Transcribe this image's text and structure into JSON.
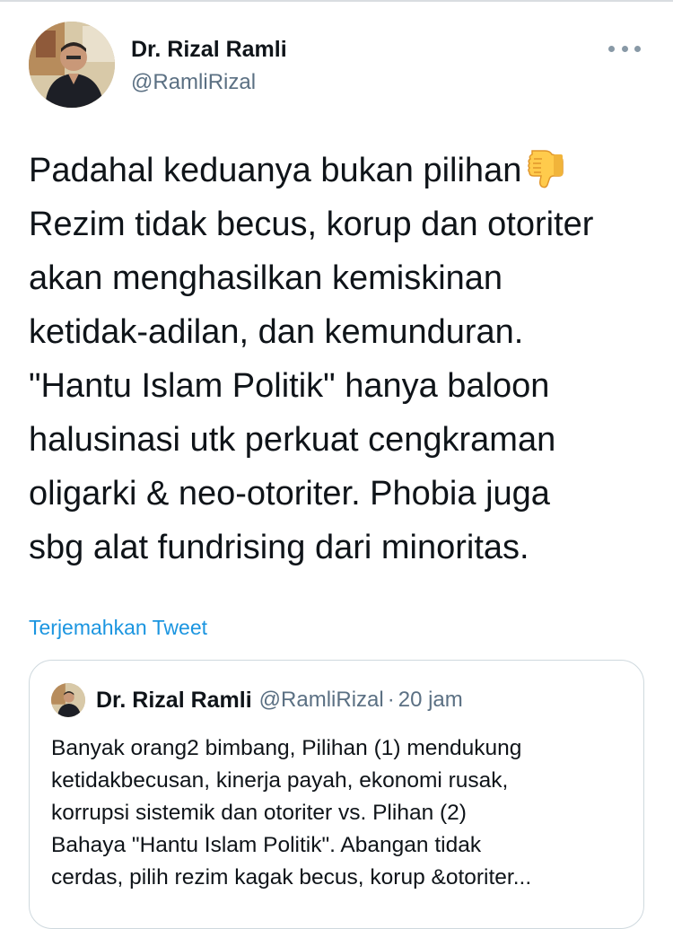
{
  "tweet": {
    "author_name": "Dr. Rizal Ramli",
    "author_handle": "@RamliRizal",
    "text_line1": "Padahal keduanya bukan pilihan",
    "text_rest": "Rezim tidak becus, korup dan otoriter\nakan menghasilkan kemiskinan\nketidak-adilan, dan kemunduran.\n\"Hantu Islam Politik\" hanya baloon\nhalusinasi utk perkuat cengkraman\noligarki & neo-otoriter. Phobia juga\nsbg alat fundrising dari minoritas.",
    "emoji": "thumbs-down-emoji",
    "translate_label": "Terjemahkan Tweet"
  },
  "quoted": {
    "author_name": "Dr. Rizal Ramli",
    "author_handle": "@RamliRizal",
    "separator": "·",
    "time": "20 jam",
    "text": "Banyak orang2 bimbang, Pilihan (1) mendukung\nketidakbecusan, kinerja payah, ekonomi rusak,\nkorrupsi sistemik dan otoriter vs. Plihan (2)\nBahaya \"Hantu Islam Politik\". Abangan tidak\ncerdas, pilih rezim kagak becus, korup &otoriter..."
  },
  "colors": {
    "link": "#1b95e0",
    "muted": "#5b7083",
    "text": "#0f1419",
    "border": "#cfd9de"
  },
  "icons": {
    "more": "more-horizontal-icon"
  }
}
